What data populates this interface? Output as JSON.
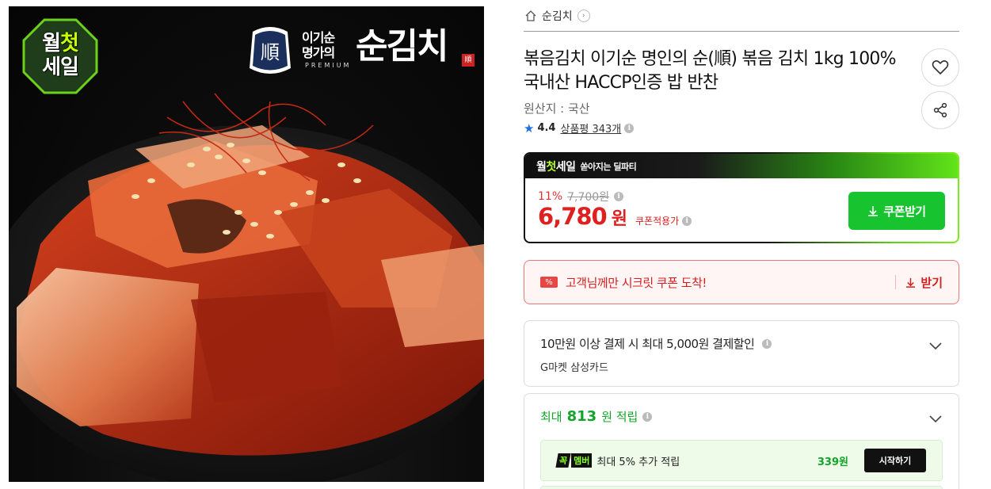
{
  "product_image": {
    "badge": {
      "line1_a": "월",
      "line1_b": "첫",
      "line2": "세일"
    },
    "brand": {
      "seal_char": "順",
      "line_a": "이기순",
      "line_b": "명가의",
      "premium": "PREMIUM",
      "name": "순김치",
      "stamp": "順"
    }
  },
  "breadcrumb": {
    "home_icon": "home-icon",
    "shop_name": "순김치",
    "chevron": "›"
  },
  "product": {
    "title": "볶음김치 이기순 명인의 순(順) 볶음 김치 1kg 100% 국내산 HACCP인증 밥 반찬",
    "origin": "원산지 : 국산",
    "rating_score": "4.4",
    "review_label": "상품평 343개"
  },
  "actions": {
    "heart_icon": "heart-icon",
    "share_icon": "share-icon"
  },
  "price_box": {
    "banner_a": "월",
    "banner_b": "첫",
    "banner_c": "세일",
    "banner_sub": "쏟아지는 딜파티",
    "discount": "11%",
    "original_price": "7,700원",
    "price": "6,780",
    "currency": "원",
    "applied_label": "쿠폰적용가",
    "coupon_button": "쿠폰받기",
    "accent_color": "#17c42f",
    "price_color": "#e01f1f"
  },
  "secret_coupon": {
    "tag": "%",
    "message": "고객님께만 시크릿 쿠폰 도착!",
    "get_label": "받기"
  },
  "card_discount": {
    "text": "10만원 이상 결제 시 최대 5,000원 결제할인",
    "card": "G마켓 삼성카드"
  },
  "points": {
    "prefix": "최대",
    "amount": "813",
    "suffix": "원 적립",
    "member_logo_a": "꼭",
    "member_logo_b": "멤버",
    "member_desc": "최대 5% 추가 적립",
    "member_points": "339원",
    "start_button": "시작하기"
  }
}
